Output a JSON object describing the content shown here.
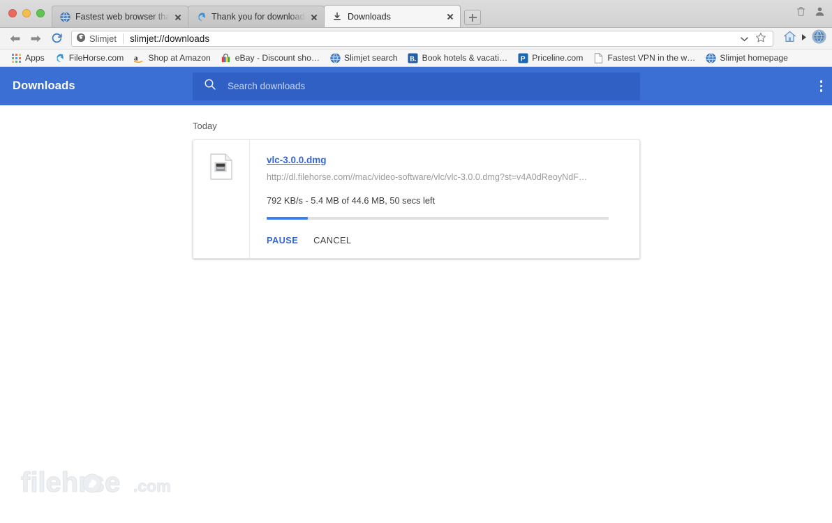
{
  "window": {
    "traffic_lights": [
      "close",
      "minimize",
      "maximize"
    ],
    "colors": {
      "close": "#eb6a5f",
      "minimize": "#f4bd4f",
      "maximize": "#61c554"
    }
  },
  "tabs": [
    {
      "title": "Fastest web browser tha",
      "icon": "globe-icon",
      "active": false,
      "close_label": "×"
    },
    {
      "title": "Thank you for downloadi",
      "icon": "slimjet-icon",
      "active": false,
      "close_label": "×"
    },
    {
      "title": "Downloads",
      "icon": "download-icon",
      "active": true,
      "close_label": "×"
    }
  ],
  "new_tab": {
    "label": "+"
  },
  "toolbar": {
    "back": "back-arrow",
    "forward": "forward-arrow",
    "reload": "reload-arrow",
    "site_chip": "Slimjet",
    "url": "slimjet://downloads",
    "dropdown": "chevron-down-icon",
    "star": "star-icon",
    "home": "home-icon",
    "play": "triangle-right-icon",
    "menu": "globe-gear-icon"
  },
  "bookmarks": [
    {
      "label": "Apps",
      "icon": "apps-grid-icon"
    },
    {
      "label": "FileHorse.com",
      "icon": "filehorse-icon"
    },
    {
      "label": "Shop at Amazon",
      "icon": "amazon-icon"
    },
    {
      "label": "eBay - Discount sho…",
      "icon": "ebay-bag-icon"
    },
    {
      "label": "Slimjet search",
      "icon": "globe-icon"
    },
    {
      "label": "Book hotels & vacati…",
      "icon": "booking-icon"
    },
    {
      "label": "Priceline.com",
      "icon": "priceline-icon"
    },
    {
      "label": "Fastest VPN in the w…",
      "icon": "page-icon"
    },
    {
      "label": "Slimjet homepage",
      "icon": "globe-icon"
    }
  ],
  "downloads_page": {
    "header": {
      "title": "Downloads",
      "search_placeholder": "Search downloads",
      "search_icon": "search-icon",
      "menu_icon": "more-vertical-icon",
      "bg_color": "#3b6fd4",
      "search_bg_color": "#3160c4"
    },
    "group_label": "Today",
    "item": {
      "file_icon": "file-document-icon",
      "file_name": "vlc-3.0.0.dmg",
      "url": "http://dl.filehorse.com//mac/video-software/vlc/vlc-3.0.0.dmg?st=v4A0dReoyNdF…",
      "status": "792 KB/s - 5.4 MB of 44.6 MB, 50 secs left",
      "speed": "792 KB/s",
      "downloaded": "5.4 MB",
      "total": "44.6 MB",
      "time_left": "50 secs left",
      "progress_percent": 12,
      "progress_color": "#3b7ef0",
      "actions": {
        "pause": "PAUSE",
        "cancel": "CANCEL"
      }
    }
  },
  "watermark": {
    "text": "filehorse",
    "suffix": ".com"
  }
}
